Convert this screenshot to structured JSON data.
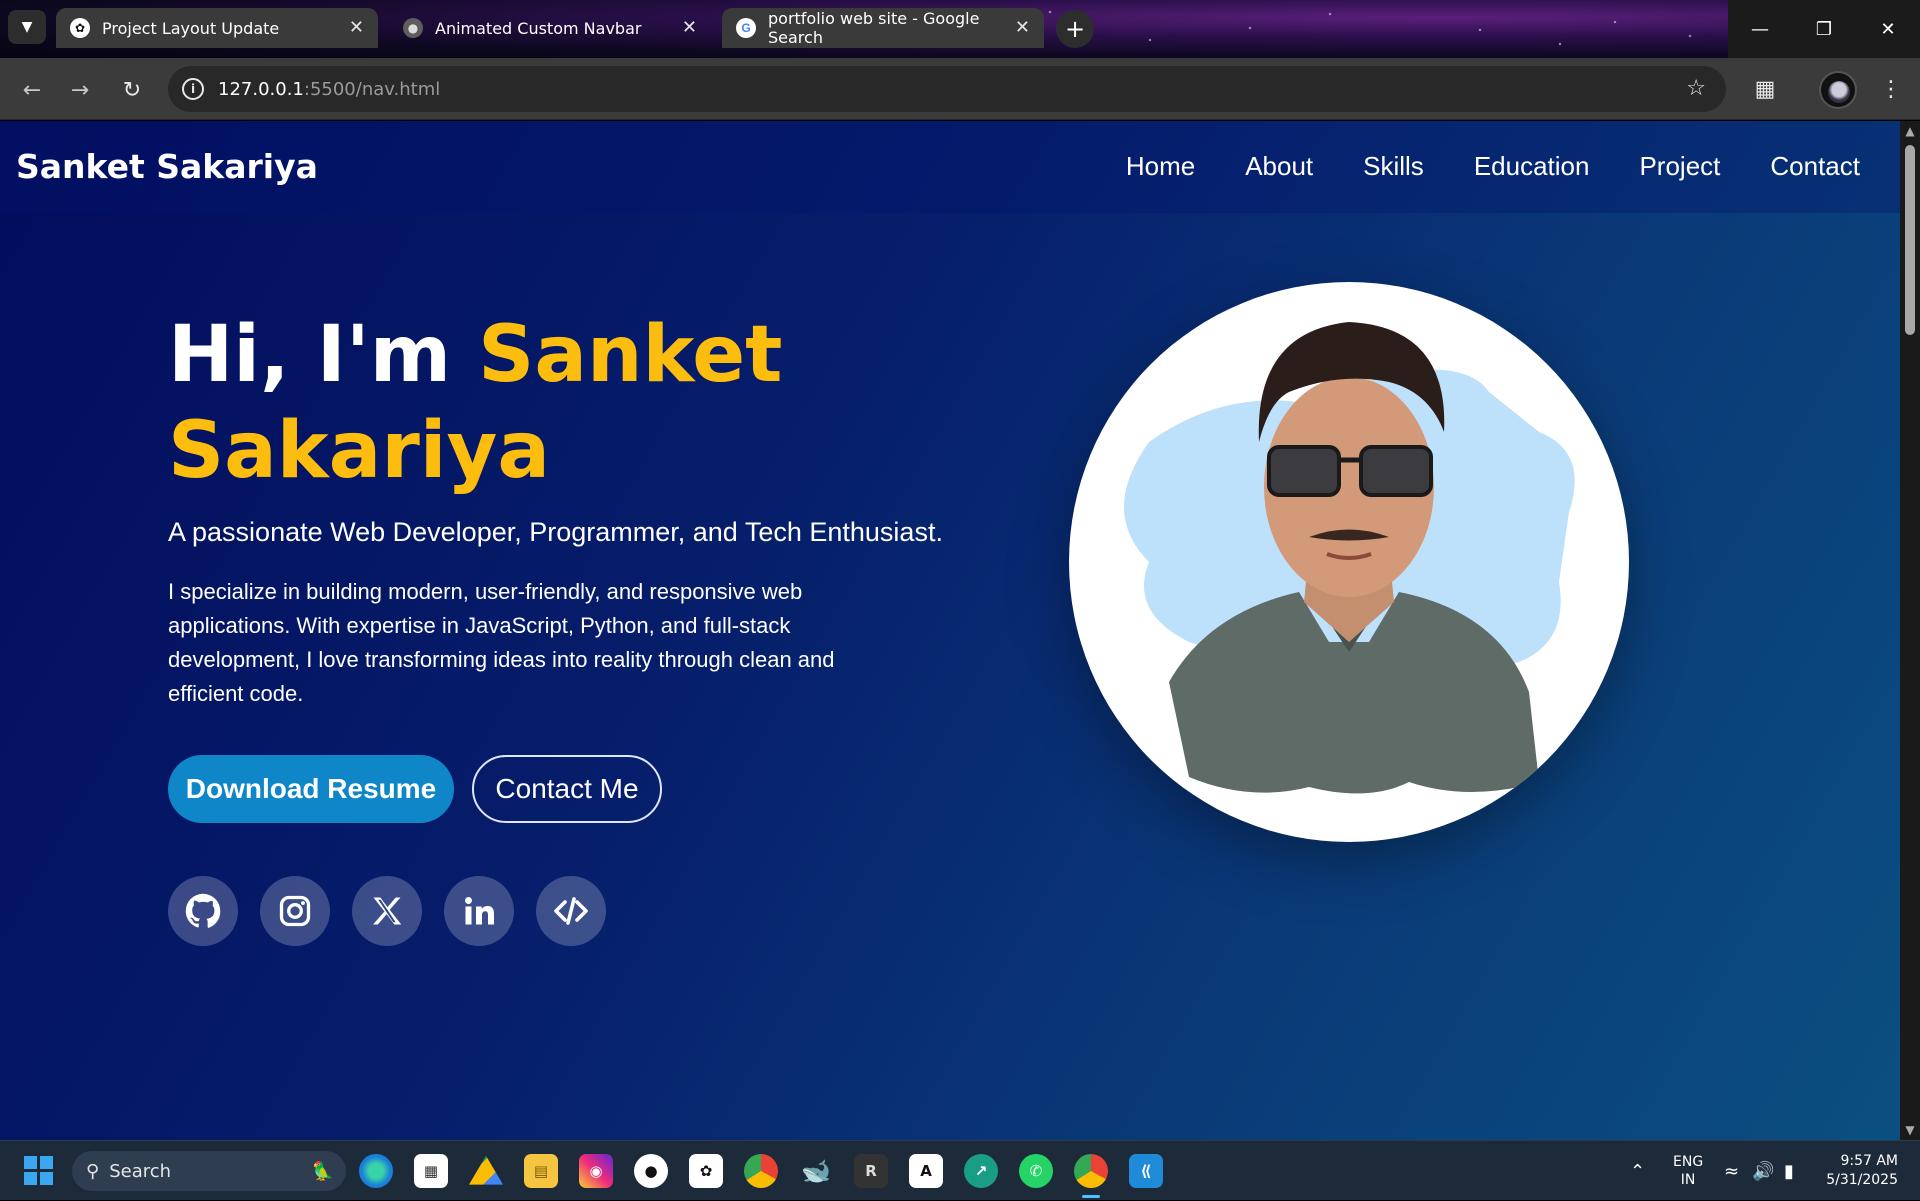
{
  "browser": {
    "tabs": [
      {
        "title": "Project Layout Update",
        "favicon": "chatgpt-icon",
        "active": false
      },
      {
        "title": "Animated Custom Navbar",
        "favicon": "globe-icon",
        "active": true
      },
      {
        "title": "portfolio web site - Google Search",
        "favicon": "google-icon",
        "active": false
      }
    ],
    "url_host": "127.0.0.1",
    "url_path": ":5500/nav.html"
  },
  "site": {
    "brand": "Sanket Sakariya",
    "nav": [
      "Home",
      "About",
      "Skills",
      "Education",
      "Project",
      "Contact"
    ],
    "hero": {
      "greeting": "Hi, I'm ",
      "name_first": "Sanket",
      "name_last": "Sakariya",
      "tagline": "A passionate Web Developer, Programmer, and Tech Enthusiast.",
      "bio": "I specialize in building modern, user-friendly, and responsive web applications. With expertise in JavaScript, Python, and full-stack development, I love transforming ideas into reality through clean and efficient code.",
      "primary_button": "Download Resume",
      "secondary_button": "Contact Me"
    },
    "socials": [
      "github-icon",
      "instagram-icon",
      "x-twitter-icon",
      "linkedin-icon",
      "code-icon"
    ],
    "colors": {
      "accent": "#fdbd0f",
      "button": "#0f86c8",
      "background_start": "#020c5c",
      "background_end": "#0b4f80"
    }
  },
  "taskbar": {
    "search_label": "Search",
    "language_top": "ENG",
    "language_bottom": "IN",
    "time": "9:57 AM",
    "date": "5/31/2025"
  }
}
